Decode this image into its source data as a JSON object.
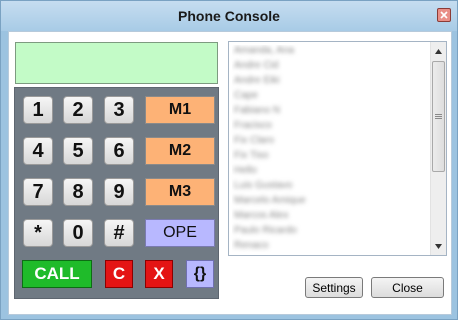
{
  "window": {
    "title": "Phone Console"
  },
  "display": {
    "value": ""
  },
  "keypad": {
    "digits": [
      "1",
      "2",
      "3",
      "4",
      "5",
      "6",
      "7",
      "8",
      "9",
      "*",
      "0",
      "#"
    ],
    "memory": [
      "M1",
      "M2",
      "M3"
    ],
    "ope": "OPE",
    "call": "CALL",
    "clear": "C",
    "cancel": "X",
    "brace": "{}"
  },
  "contacts": [
    "Amanda, Ana",
    "Andre Cid",
    "Andre Eiki",
    "Cape",
    "Fabiano N",
    "Fracisco",
    "Fix Claro",
    "Fix Tiso",
    "Hello",
    "Luis Gustavo",
    "Marcelo Amique",
    "Marcos Alex",
    "Paulo Ricardo",
    "Renaco"
  ],
  "buttons": {
    "settings": "Settings",
    "close": "Close"
  },
  "colors": {
    "display_bg": "#c3fbc7",
    "keypad_bg": "#707a84",
    "memory_key": "#fdb276",
    "ope_key": "#b8b8ff",
    "call_key": "#1fbb2a",
    "red_key": "#e41414"
  }
}
